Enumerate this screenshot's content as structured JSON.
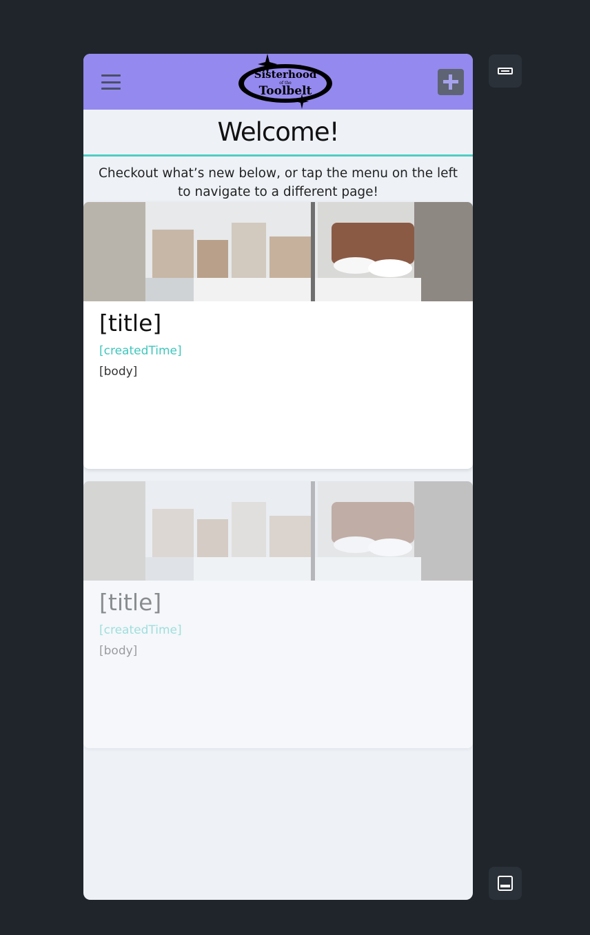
{
  "header": {
    "logo_text_line1": "Sisterhood",
    "logo_text_line2": "of the",
    "logo_text_line3": "Toolbelt",
    "menu_icon": "hamburger-icon",
    "add_icon": "plus-icon"
  },
  "main": {
    "heading": "Welcome!",
    "intro": "Checkout what’s new below, or tap the menu on the left to navigate to a different page!"
  },
  "cards": [
    {
      "title": "[title]",
      "created_time": "[createdTime]",
      "body": "[body]"
    },
    {
      "title": "[title]",
      "created_time": "[createdTime]",
      "body": "[body]"
    }
  ],
  "side_controls": {
    "top_icon": "horizontal-bar-icon",
    "bottom_icon": "bottom-panel-icon"
  },
  "colors": {
    "background": "#1f252b",
    "header": "#9489ee",
    "accent": "#4ecdc4",
    "add_button": "#5e6473",
    "page": "#eef2f7"
  }
}
